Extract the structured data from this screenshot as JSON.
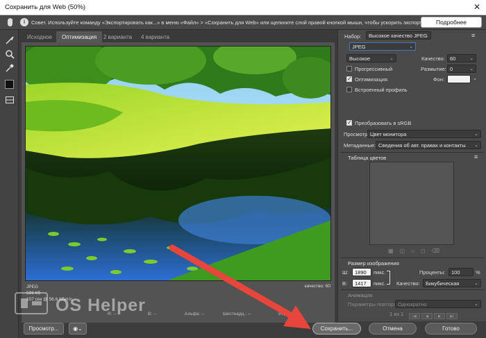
{
  "window": {
    "title": "Сохранить для Web (50%)",
    "close_glyph": "✕"
  },
  "hint": {
    "text": "Совет. Используйте команду «Экспортировать как...» в меню «Файл» > «Сохранить для Web» или щелкните слой правой кнопкой мыши, чтобы ускорить экспорт ресурсов",
    "more_button": "Подробнее"
  },
  "tabs": [
    {
      "label": "Исходное",
      "active": false
    },
    {
      "label": "Оптимизация",
      "active": true
    },
    {
      "label": "2 варианта",
      "active": false
    },
    {
      "label": "4 варианта",
      "active": false
    }
  ],
  "image_info": {
    "format": "JPEG",
    "size": "596 Кб",
    "time": "107 сек @ 56,6 Кбит/с",
    "quality": "качество: 60"
  },
  "status": {
    "r": "R: --",
    "g": "G: --",
    "b": "B: --",
    "alpha": "Альфа: --",
    "hex": "Шестнадц.: --",
    "index": "Индекс: --"
  },
  "watermark": {
    "text": "OS Helper"
  },
  "panel": {
    "preset_label": "Набор:",
    "preset_value": "Высокое качество JPEG",
    "format_value": "JPEG",
    "compression_value": "Высокое",
    "quality_label": "Качество:",
    "quality_value": "60",
    "progressive_label": "Прогрессивный",
    "progressive_checked": false,
    "blur_label": "Размытие:",
    "blur_value": "0",
    "optimized_label": "Оптимизация",
    "optimized_checked": true,
    "matte_label": "Фон:",
    "embed_profile_label": "Встроенный профиль",
    "embed_profile_checked": false,
    "convert_srgb_label": "Преобразовать в sRGB",
    "convert_srgb_checked": true,
    "preview_label": "Просмотр:",
    "preview_value": "Цвет монитора",
    "metadata_label": "Метаданные:",
    "metadata_value": "Сведения об авт. правах и контакты",
    "color_table_title": "Таблица цветов",
    "image_size_title": "Размер изображения",
    "width_label": "Ш:",
    "width_value": "1890",
    "height_label": "В:",
    "height_value": "1417",
    "unit": "пикс.",
    "percent_label": "Проценты:",
    "percent_value": "100",
    "percent_sign": "%",
    "resample_label": "Качество:",
    "resample_value": "Бикубическая",
    "animation_title": "Анимация",
    "loop_label": "Параметры повторов:",
    "loop_value": "Однократно",
    "frame_counter": "1 из 1"
  },
  "footer": {
    "preview_button": "Просмотр...",
    "save_button": "Сохранить...",
    "cancel_button": "Отмена",
    "done_button": "Готово"
  },
  "colors": {
    "arrow": "#e8453c",
    "accent": "#4a76c6"
  }
}
